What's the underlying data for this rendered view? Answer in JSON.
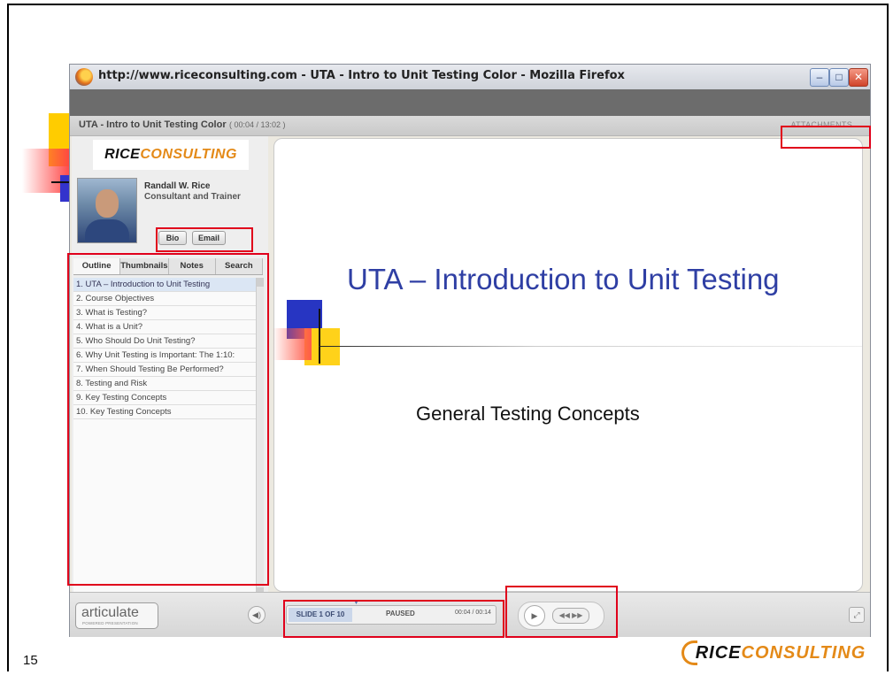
{
  "window": {
    "title": "http://www.riceconsulting.com - UTA - Intro to Unit Testing Color - Mozilla Firefox",
    "min_glyph": "–",
    "max_glyph": "□",
    "close_glyph": "✕"
  },
  "player": {
    "course_title": "UTA - Intro to Unit Testing Color",
    "course_time": "( 00:04 / 13:02 )",
    "attachments_label": "ATTACHMENTS",
    "logo_rice": "RICE",
    "logo_consulting": "CONSULTING",
    "presenter_name": "Randall W. Rice",
    "presenter_role": "Consultant and Trainer",
    "bio_label": "Bio",
    "email_label": "Email",
    "tabs": [
      {
        "label": "Outline"
      },
      {
        "label": "Thumbnails"
      },
      {
        "label": "Notes"
      },
      {
        "label": "Search"
      }
    ],
    "outline": [
      "1. UTA – Introduction to Unit Testing",
      "2. Course Objectives",
      "3. What is Testing?",
      "4. What is a Unit?",
      "5. Who Should Do Unit Testing?",
      "6. Why Unit Testing is Important: The 1:10:",
      "7. When Should Testing Be Performed?",
      "8. Testing and Risk",
      "9. Key Testing Concepts",
      "10. Key Testing Concepts"
    ],
    "slide_title": "UTA – Introduction to Unit Testing",
    "slide_subtitle": "General Testing Concepts",
    "articulate_label": "articulate",
    "articulate_sub": "POWERED PRESENTATION",
    "slide_counter": "SLIDE 1 OF 10",
    "status": "PAUSED",
    "timer": "00:04 / 00:14",
    "volume_glyph": "◀)",
    "play_glyph": "▶",
    "nav_glyph": "◀◀  ▶▶",
    "fullscreen_glyph": "⤢",
    "marker_glyph": "▼"
  },
  "page": {
    "number": "15",
    "logo_rice": "RICE",
    "logo_consulting": "CONSULTING"
  },
  "icons": {
    "browser": "firefox-icon",
    "volume": "speaker-icon",
    "play": "play-icon",
    "navigation": "prev-next-icon",
    "fullscreen": "fullscreen-icon"
  },
  "colors": {
    "highlight": "#e0001b",
    "slide_title": "#2f3fa4",
    "brand_orange": "#e48a18"
  }
}
